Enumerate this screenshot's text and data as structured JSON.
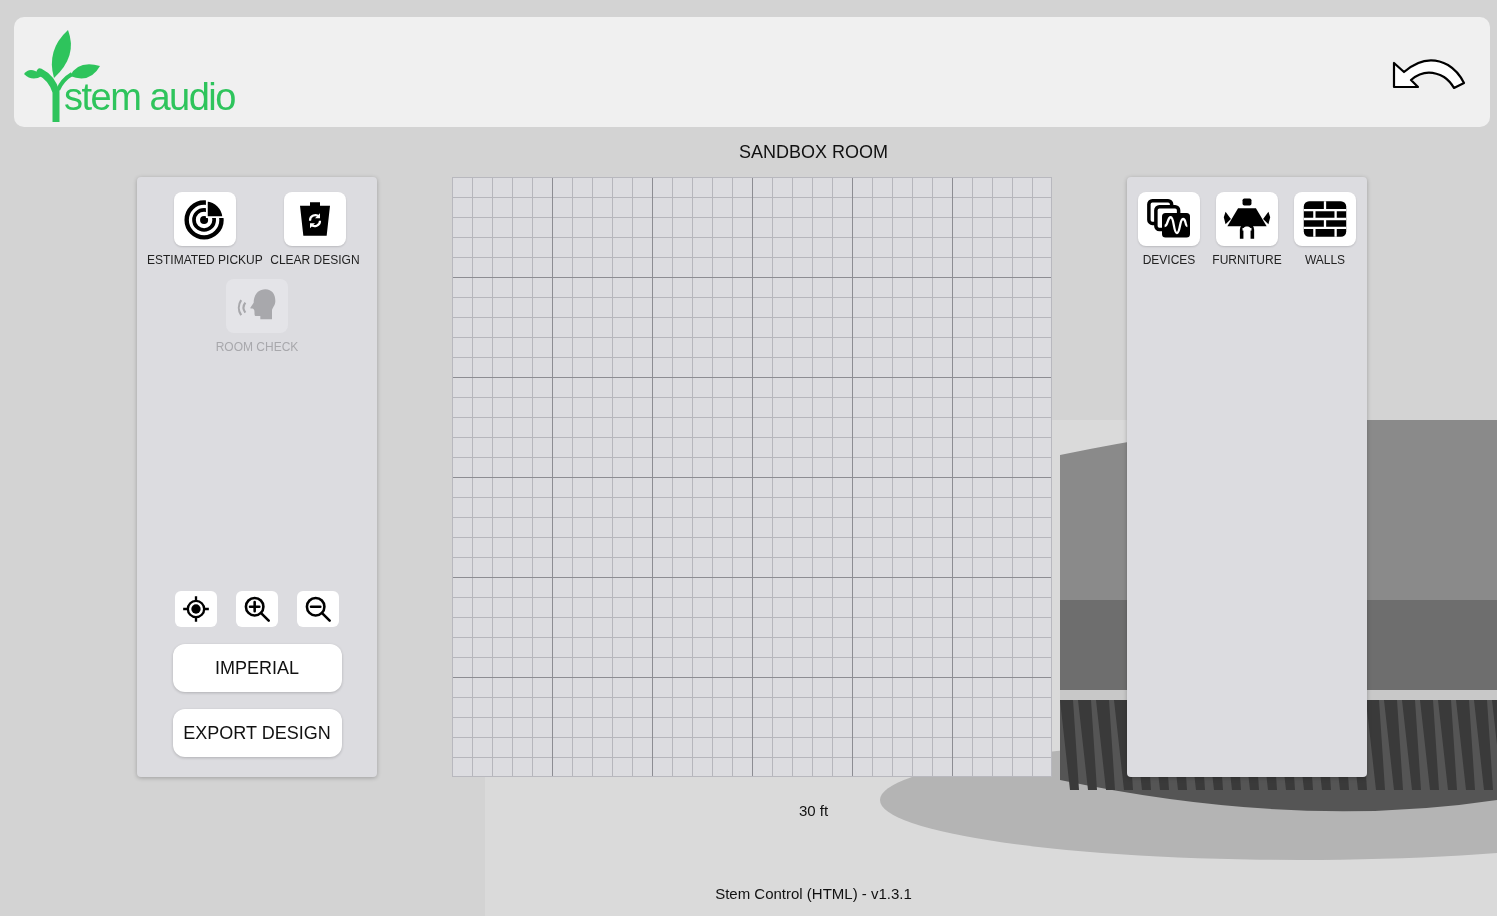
{
  "header": {
    "logo": "stem audio"
  },
  "room_title": "SANDBOX ROOM",
  "left_tools": [
    {
      "label": "ESTIMATED PICKUP",
      "disabled": false
    },
    {
      "label": "CLEAR DESIGN",
      "disabled": false
    },
    {
      "label": "ROOM CHECK",
      "disabled": true
    }
  ],
  "unit_button": "IMPERIAL",
  "export_button": "EXPORT DESIGN",
  "right_tools": [
    {
      "label": "DEVICES"
    },
    {
      "label": "FURNITURE"
    },
    {
      "label": "WALLS"
    }
  ],
  "scale_label": "30 ft",
  "footer": "Stem Control (HTML) - v1.3.1"
}
